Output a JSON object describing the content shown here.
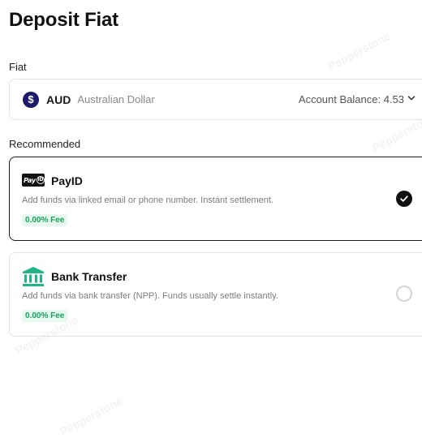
{
  "page": {
    "title": "Deposit Fiat"
  },
  "fiat_section": {
    "label": "Fiat",
    "currency_code": "AUD",
    "currency_name": "Australian Dollar",
    "currency_symbol": "$",
    "balance_text": "Account Balance: 4.53"
  },
  "recommended_section": {
    "label": "Recommended"
  },
  "methods": [
    {
      "name": "PayID",
      "description": "Add funds via linked email or phone number. Instant settlement.",
      "fee": "0.00% Fee",
      "selected": true,
      "icon": "payid-logo-icon",
      "logo_text": "Pay",
      "logo_id_text": "ID"
    },
    {
      "name": "Bank Transfer",
      "description": "Add funds via bank transfer (NPP). Funds usually settle instantly.",
      "fee": "0.00% Fee",
      "selected": false,
      "icon": "bank-icon"
    }
  ],
  "colors": {
    "accent_dark": "#111111",
    "currency_icon_bg": "#1b1a6b",
    "fee_text": "#17a35a",
    "fee_bg": "#e7f8ef",
    "bank_icon": "#20b486"
  },
  "watermark_text": "Pepperstone"
}
